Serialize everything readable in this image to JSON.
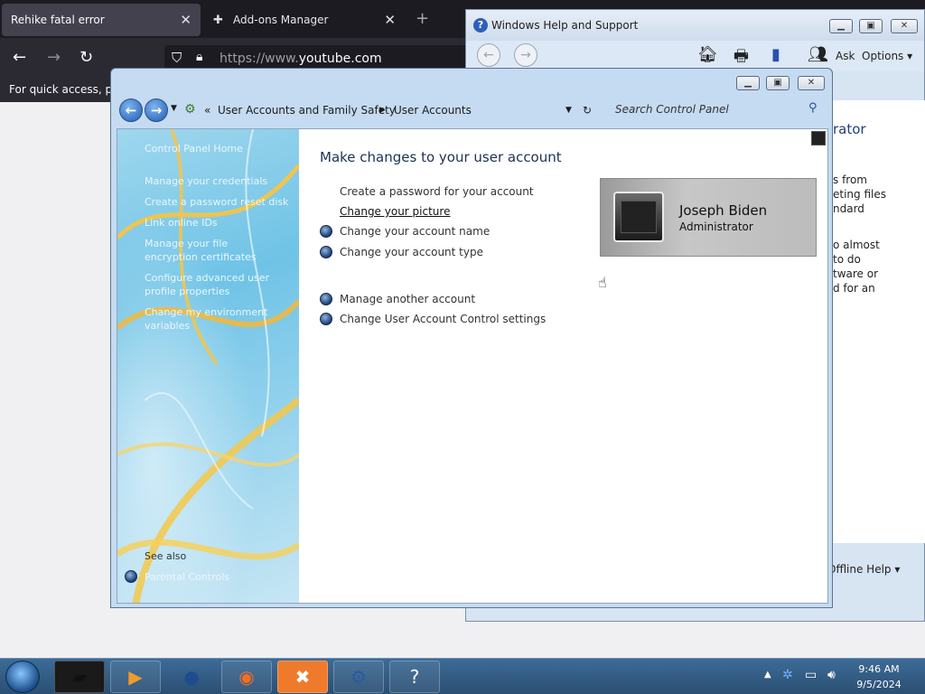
{
  "browser": {
    "tabs": [
      {
        "label": "Rehike fatal error"
      },
      {
        "label": "Add-ons Manager"
      }
    ],
    "url_prefix": "https://www.",
    "url_domain": "youtube.com",
    "bookmarks_hint": "For quick access, plac"
  },
  "help_window": {
    "title": "Windows Help and Support",
    "ask_label": "Ask",
    "options_label": "Options",
    "body_fragments": [
      "rator",
      "s from",
      "eting files",
      "ndard",
      "o almost",
      "to do",
      "tware or",
      "d for an"
    ],
    "footer": "Offline Help"
  },
  "control_panel": {
    "breadcrumb": {
      "root": "«",
      "item1": "User Accounts and Family Safety",
      "item2": "User Accounts"
    },
    "search_placeholder": "Search Control Panel",
    "left_nav": {
      "home": "Control Panel Home",
      "items": [
        "Manage your credentials",
        "Create a password reset disk",
        "Link online IDs",
        "Manage your file encryption certificates",
        "Configure advanced user profile properties",
        "Change my environment variables"
      ],
      "see_also": "See also",
      "parental": "Parental Controls"
    },
    "heading": "Make changes to your user account",
    "tasks": [
      "Create a password for your account",
      "Change your picture",
      "Change your account name",
      "Change your account type"
    ],
    "other_tasks": [
      "Manage another account",
      "Change User Account Control settings"
    ],
    "user": {
      "name": "Joseph Biden",
      "role": "Administrator"
    }
  },
  "taskbar": {
    "time": "9:46 AM",
    "date": "9/5/2024"
  }
}
